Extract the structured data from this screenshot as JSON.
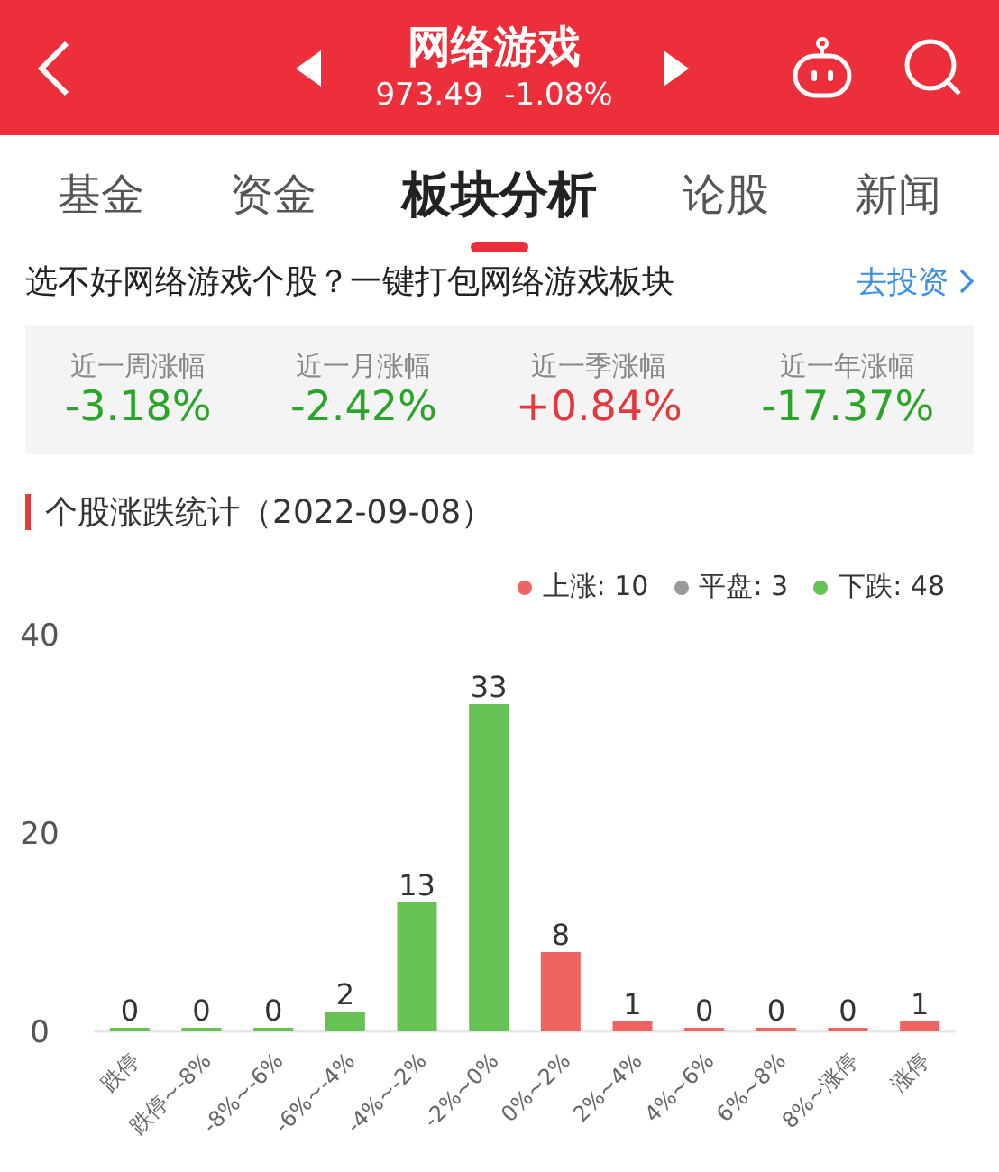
{
  "header": {
    "title": "网络游戏",
    "price": "973.49",
    "change": "-1.08%"
  },
  "tabs": [
    {
      "label": "基金",
      "selected": false
    },
    {
      "label": "资金",
      "selected": false
    },
    {
      "label": "板块分析",
      "selected": true
    },
    {
      "label": "论股",
      "selected": false
    },
    {
      "label": "新闻",
      "selected": false
    }
  ],
  "promo": {
    "text": "选不好网络游戏个股？一键打包网络游戏板块",
    "link": "去投资"
  },
  "stats": [
    {
      "label": "近一周涨幅",
      "value": "-3.18%",
      "color": "#2aa52a"
    },
    {
      "label": "近一月涨幅",
      "value": "-2.42%",
      "color": "#2aa52a"
    },
    {
      "label": "近一季涨幅",
      "value": "+0.84%",
      "color": "#e2393e"
    },
    {
      "label": "近一年涨幅",
      "value": "-17.37%",
      "color": "#2aa52a"
    }
  ],
  "section": {
    "title": "个股涨跌统计（2022-09-08）",
    "legend": [
      {
        "label": "上涨: 10",
        "color": "#ee6460"
      },
      {
        "label": "平盘: 3",
        "color": "#9a9a9a"
      },
      {
        "label": "下跌: 48",
        "color": "#66c255"
      }
    ],
    "chart_data": {
      "type": "bar",
      "categories": [
        "跌停",
        "跌停~-8%",
        "-8%~-6%",
        "-6%~-4%",
        "-4%~-2%",
        "-2%~0%",
        "0%~2%",
        "2%~4%",
        "4%~6%",
        "6%~8%",
        "8%~涨停",
        "涨停"
      ],
      "series": [
        {
          "color": "#66c255",
          "values": [
            0,
            0,
            0,
            2,
            13,
            33,
            null,
            null,
            null,
            null,
            null,
            null
          ]
        },
        {
          "color": "#ee6460",
          "values": [
            null,
            null,
            null,
            null,
            null,
            null,
            8,
            1,
            0,
            0,
            0,
            1
          ]
        }
      ],
      "ylim": [
        0,
        40
      ],
      "yticks": [
        0,
        20,
        40
      ],
      "data_labels": true
    }
  }
}
